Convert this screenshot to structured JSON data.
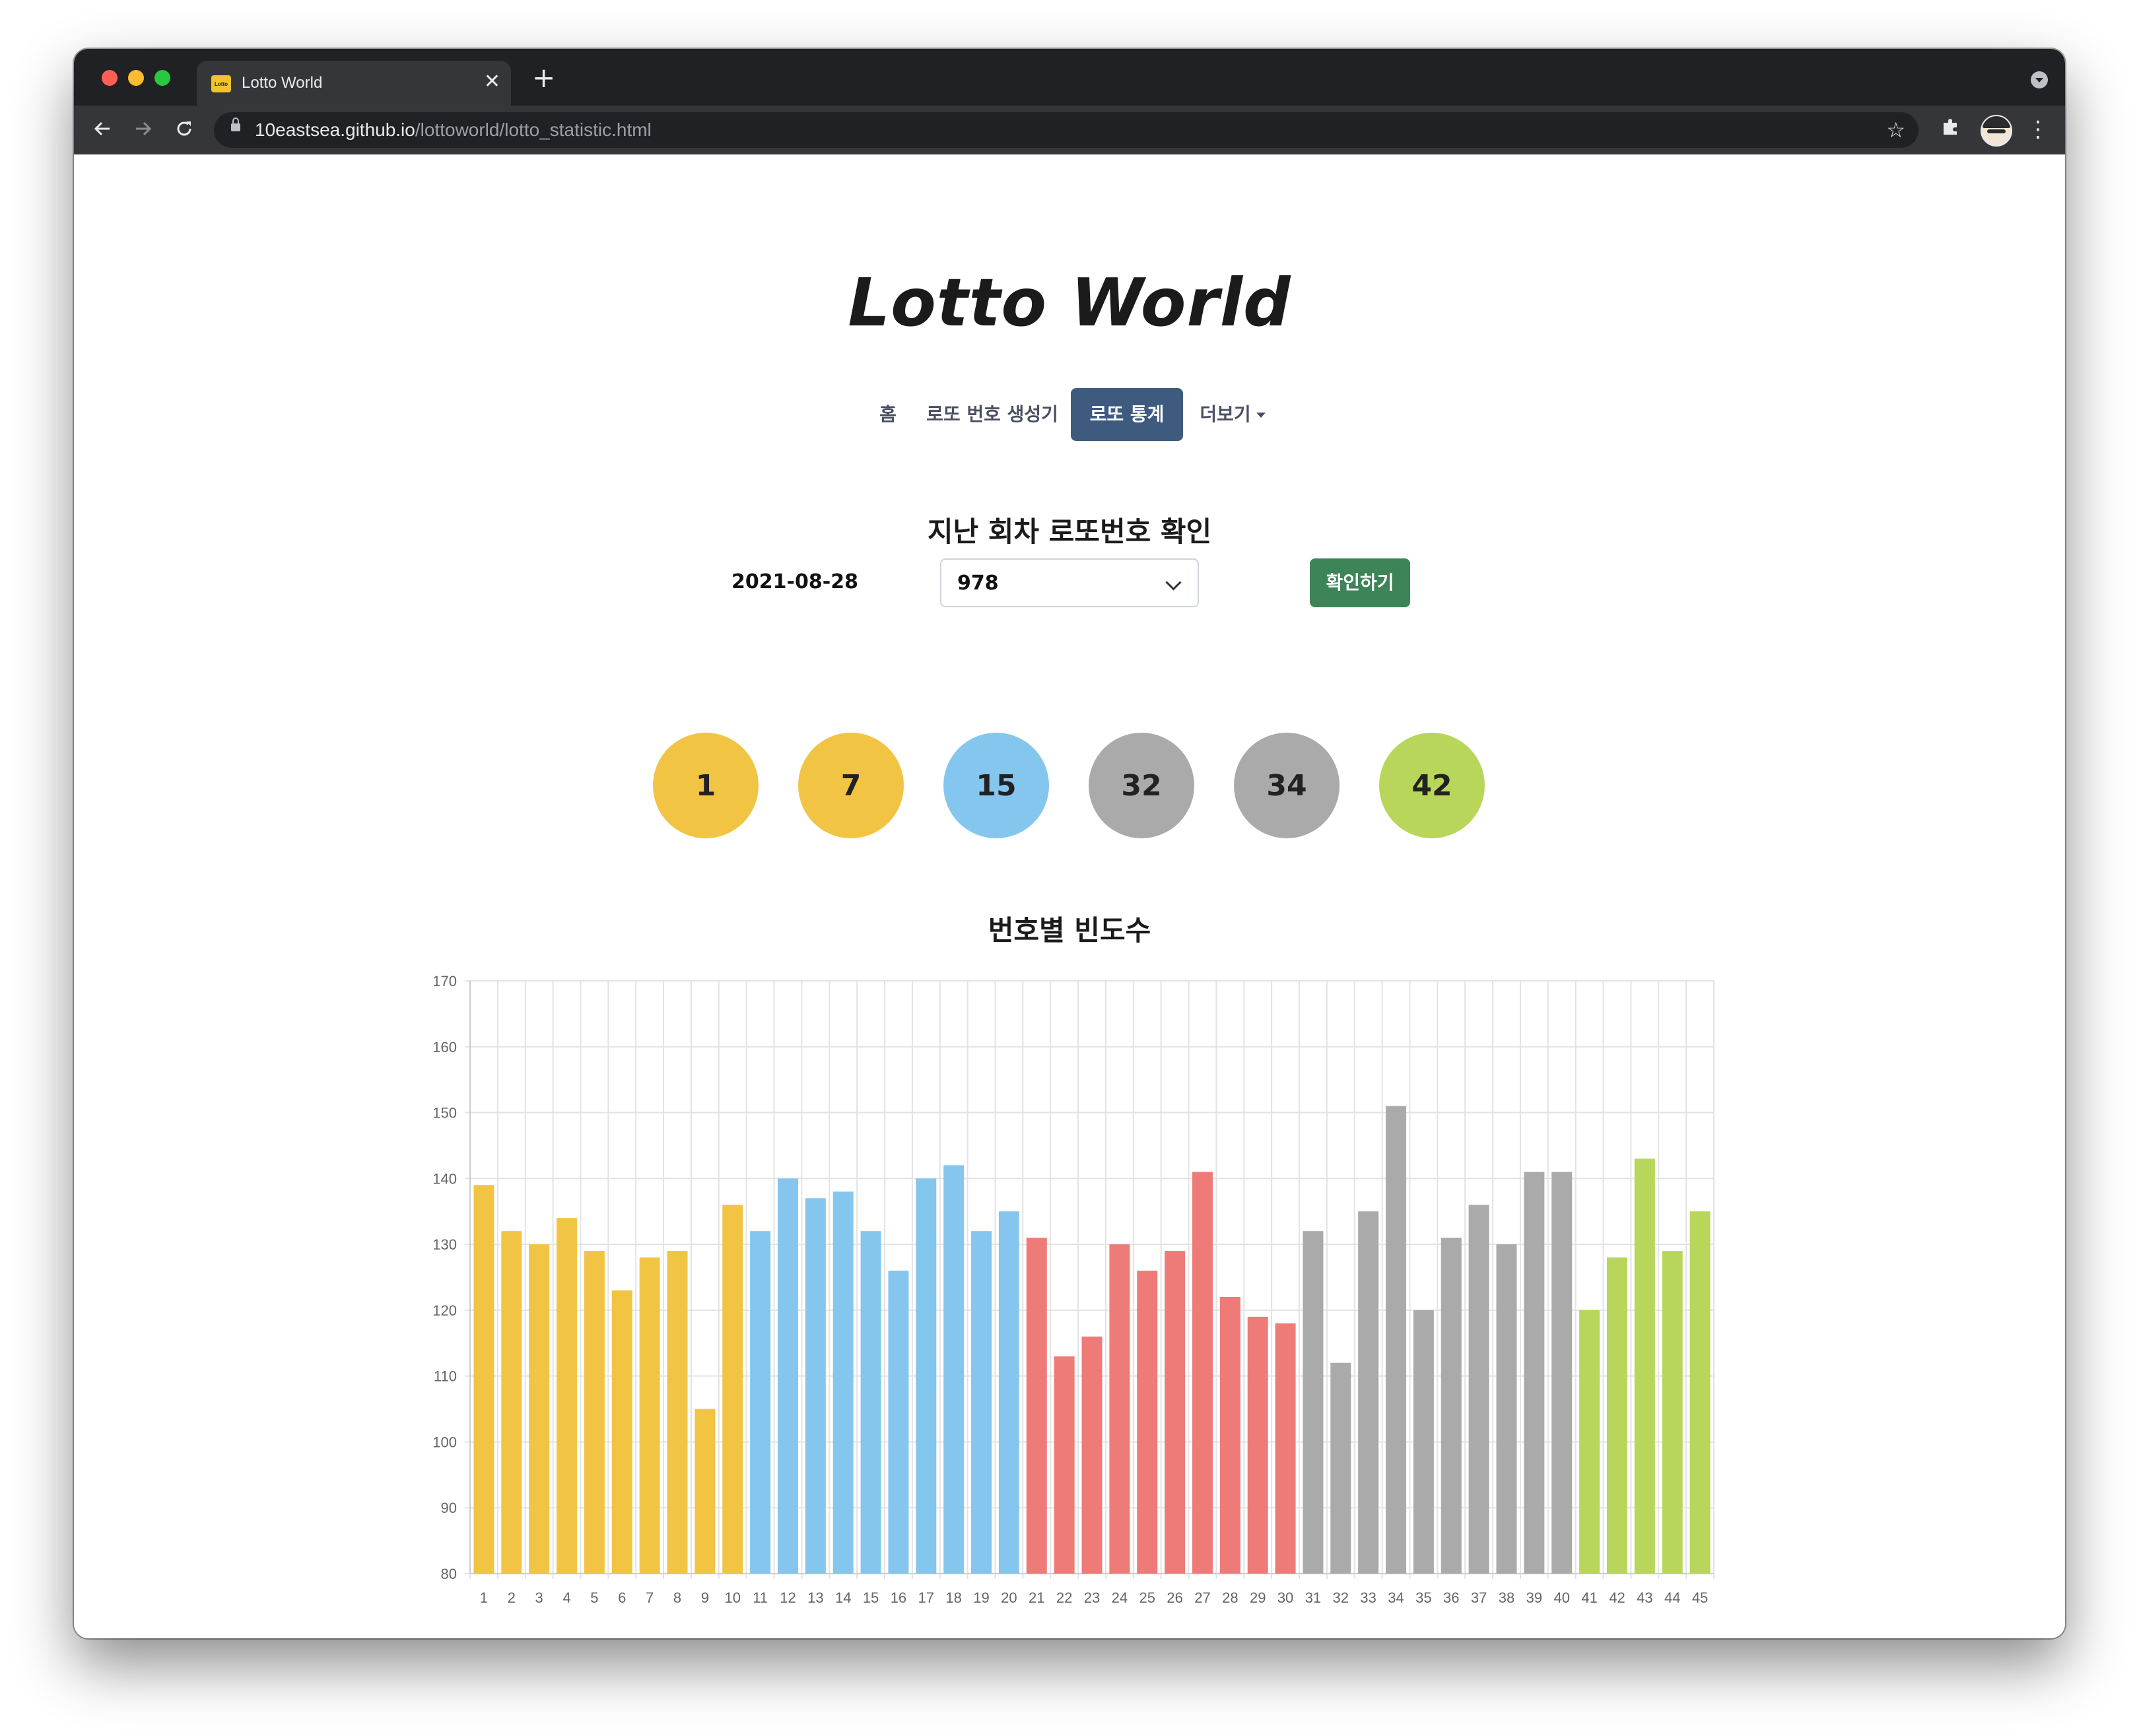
{
  "browser": {
    "tab_title": "Lotto World",
    "favicon_text": "Lotto",
    "new_tab": "+",
    "close": "✕",
    "url_host": "10eastsea.github.io",
    "url_path": "/lottoworld/lotto_statistic.html"
  },
  "site": {
    "title": "Lotto World",
    "nav": [
      {
        "label": "홈",
        "active": false
      },
      {
        "label": "로또 번호 생성기",
        "active": false
      },
      {
        "label": "로또 통계",
        "active": true
      },
      {
        "label": "더보기",
        "active": false,
        "dropdown": true
      }
    ]
  },
  "draw": {
    "heading": "지난 회차 로또번호 확인",
    "date": "2021-08-28",
    "round_selected": "978",
    "confirm_label": "확인하기",
    "balls": [
      {
        "number": "1",
        "color": "#f2c444"
      },
      {
        "number": "7",
        "color": "#f2c444"
      },
      {
        "number": "15",
        "color": "#85c6ee"
      },
      {
        "number": "32",
        "color": "#aaaaaa"
      },
      {
        "number": "34",
        "color": "#aaaaaa"
      },
      {
        "number": "42",
        "color": "#b8d65a"
      }
    ]
  },
  "chart_heading": "번호별 빈도수",
  "chart_data": {
    "type": "bar",
    "categories": [
      "1",
      "2",
      "3",
      "4",
      "5",
      "6",
      "7",
      "8",
      "9",
      "10",
      "11",
      "12",
      "13",
      "14",
      "15",
      "16",
      "17",
      "18",
      "19",
      "20",
      "21",
      "22",
      "23",
      "24",
      "25",
      "26",
      "27",
      "28",
      "29",
      "30",
      "31",
      "32",
      "33",
      "34",
      "35",
      "36",
      "37",
      "38",
      "39",
      "40",
      "41",
      "42",
      "43",
      "44",
      "45"
    ],
    "values": [
      139,
      132,
      130,
      134,
      129,
      123,
      128,
      129,
      105,
      136,
      132,
      140,
      137,
      138,
      132,
      126,
      140,
      142,
      132,
      135,
      131,
      113,
      116,
      130,
      126,
      129,
      141,
      122,
      119,
      118,
      132,
      112,
      135,
      151,
      120,
      131,
      136,
      130,
      141,
      141,
      120,
      128,
      143,
      129,
      135
    ],
    "ylim": [
      80,
      170
    ],
    "yticks": [
      "170",
      "160",
      "150",
      "140",
      "130",
      "120",
      "110",
      "100",
      "90",
      "80"
    ],
    "grid": true,
    "group_colors": {
      "1-10": "#f2c444",
      "11-20": "#85c6ee",
      "21-30": "#ee7b78",
      "31-40": "#aaaaaa",
      "41-45": "#b8d65a"
    }
  }
}
